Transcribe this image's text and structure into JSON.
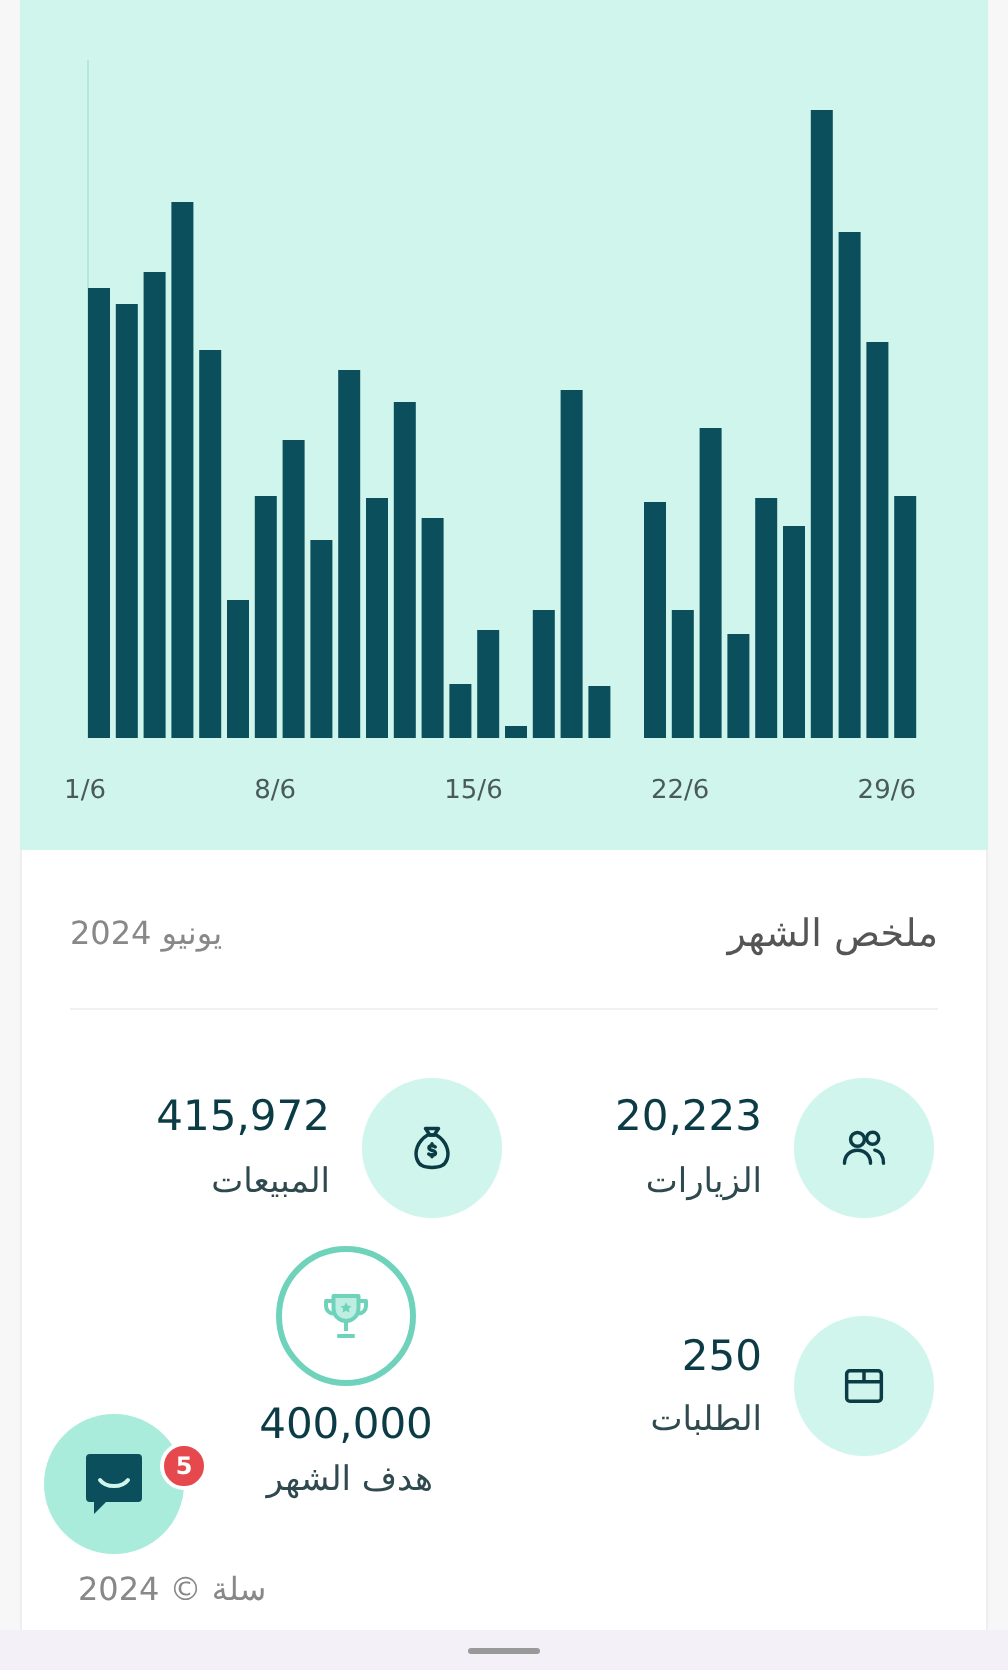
{
  "chart": {
    "x_labels": [
      "29/6",
      "22/6",
      "15/6",
      "8/6",
      "1/6"
    ]
  },
  "summary": {
    "title": "ملخص الشهر",
    "period": "يونيو 2024",
    "stats": [
      {
        "kind": "visits",
        "value": "20,223",
        "label": "الزيارات"
      },
      {
        "kind": "sales",
        "value": "415,972",
        "label": "المبيعات"
      },
      {
        "kind": "orders",
        "value": "250",
        "label": "الطلبات"
      },
      {
        "kind": "goal",
        "value": "400,000",
        "label": "هدف الشهر"
      }
    ]
  },
  "footer": "سلة © 2024",
  "chat": {
    "badge": "5"
  }
}
